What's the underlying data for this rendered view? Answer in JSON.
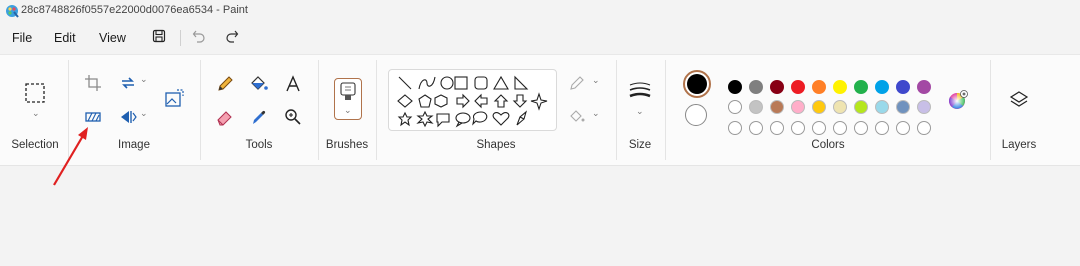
{
  "window": {
    "title": "28c8748826f0557e22000d0076ea6534 - Paint"
  },
  "menu": {
    "file": "File",
    "edit": "Edit",
    "view": "View"
  },
  "icons": {
    "app": "paint-app-icon",
    "save": "save-icon",
    "undo": "undo-icon",
    "redo": "redo-icon",
    "select": "rectangle-select-icon",
    "crop": "crop-icon",
    "rotate": "rotate-icon",
    "resize": "resize-skew-icon",
    "flip": "flip-icon",
    "image_crop_ai": "image-remove-background-icon",
    "pencil": "pencil-icon",
    "fill": "fill-bucket-icon",
    "text": "text-icon",
    "eraser": "eraser-icon",
    "color_picker": "color-picker-icon",
    "magnifier": "magnifier-icon",
    "brush": "brush-icon",
    "size": "line-size-icon",
    "edit_colors": "edit-colors-icon",
    "layers": "layers-icon"
  },
  "groups": {
    "selection": "Selection",
    "image": "Image",
    "tools": "Tools",
    "brushes": "Brushes",
    "shapes": "Shapes",
    "size": "Size",
    "colors": "Colors",
    "layers": "Layers"
  },
  "colors": {
    "primary": "#000000",
    "secondary": "#ffffff",
    "accent": "#b0734b",
    "annotation_arrow": "#e02020",
    "palette_row1": [
      "#000000",
      "#7f7f7f",
      "#880015",
      "#ed1c24",
      "#ff7f27",
      "#fff200",
      "#22b14c",
      "#00a2e8",
      "#3f48cc",
      "#a349a4"
    ],
    "palette_row2": [
      "#ffffff",
      "#c3c3c3",
      "#b97a57",
      "#ffaec9",
      "#ffc90e",
      "#efe4b0",
      "#b5e61d",
      "#99d9ea",
      "#7092be",
      "#c8bfe7"
    ],
    "palette_row3_empty": 10
  }
}
